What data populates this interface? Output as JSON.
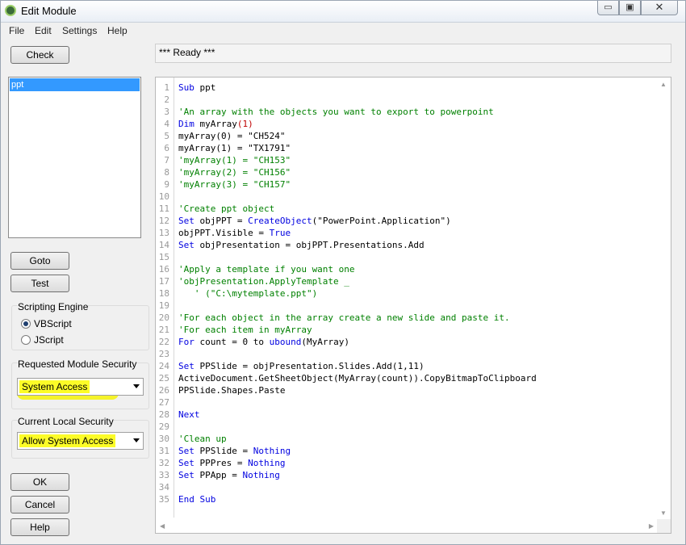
{
  "window": {
    "title": "Edit Module",
    "min_glyph": "▭",
    "max_glyph": "▣",
    "close_glyph": "✕"
  },
  "menu": [
    "File",
    "Edit",
    "Settings",
    "Help"
  ],
  "buttons": {
    "check": "Check",
    "goto": "Goto",
    "test": "Test",
    "ok": "OK",
    "cancel": "Cancel",
    "help": "Help"
  },
  "status": "*** Ready ***",
  "modules": [
    "ppt"
  ],
  "scripting_engine": {
    "label": "Scripting Engine",
    "options": [
      "VBScript",
      "JScript"
    ],
    "selected": "VBScript"
  },
  "requested_security": {
    "label": "Requested Module Security",
    "value": "System Access"
  },
  "local_security": {
    "label": "Current Local Security",
    "value": "Allow System Access"
  },
  "colors": {
    "highlight": "#f5f32a",
    "keyword": "#0000e0",
    "comment": "#008000",
    "selection": "#3399ff"
  },
  "code_lines": [
    [
      [
        "kw",
        "Sub"
      ],
      [
        "t",
        " ppt"
      ]
    ],
    [],
    [
      [
        "cm",
        "'An array with the objects you want to export to powerpoint"
      ]
    ],
    [
      [
        "kw",
        "Dim"
      ],
      [
        "t",
        " myArray"
      ],
      [
        "err",
        "(1)"
      ]
    ],
    [
      [
        "t",
        "myArray(0) = \"CH524\""
      ]
    ],
    [
      [
        "t",
        "myArray(1) = \"TX1791\""
      ]
    ],
    [
      [
        "cm",
        "'myArray(1) = \"CH153\""
      ]
    ],
    [
      [
        "cm",
        "'myArray(2) = \"CH156\""
      ]
    ],
    [
      [
        "cm",
        "'myArray(3) = \"CH157\""
      ]
    ],
    [],
    [
      [
        "cm",
        "'Create ppt object"
      ]
    ],
    [
      [
        "kw",
        "Set"
      ],
      [
        "t",
        " objPPT = "
      ],
      [
        "kw",
        "CreateObject"
      ],
      [
        "t",
        "(\"PowerPoint.Application\")"
      ]
    ],
    [
      [
        "t",
        "objPPT.Visible = "
      ],
      [
        "kw",
        "True"
      ]
    ],
    [
      [
        "kw",
        "Set"
      ],
      [
        "t",
        " objPresentation = objPPT.Presentations.Add"
      ]
    ],
    [],
    [
      [
        "cm",
        "'Apply a template if you want one"
      ]
    ],
    [
      [
        "cm",
        "'objPresentation.ApplyTemplate _"
      ]
    ],
    [
      [
        "cm",
        "   ' (\"C:\\mytemplate.ppt\")"
      ]
    ],
    [],
    [
      [
        "cm",
        "'For each object in the array create a new slide and paste it."
      ]
    ],
    [
      [
        "cm",
        "'For each item in myArray"
      ]
    ],
    [
      [
        "kw",
        "For"
      ],
      [
        "t",
        " count = 0 to "
      ],
      [
        "kw",
        "ubound"
      ],
      [
        "t",
        "(MyArray)"
      ]
    ],
    [],
    [
      [
        "kw",
        "Set"
      ],
      [
        "t",
        " PPSlide = objPresentation.Slides.Add(1,11)"
      ]
    ],
    [
      [
        "t",
        "ActiveDocument.GetSheetObject(MyArray(count)).CopyBitmapToClipboard"
      ]
    ],
    [
      [
        "t",
        "PPSlide.Shapes.Paste"
      ]
    ],
    [],
    [
      [
        "kw",
        "Next"
      ]
    ],
    [],
    [
      [
        "cm",
        "'Clean up"
      ]
    ],
    [
      [
        "kw",
        "Set"
      ],
      [
        "t",
        " PPSlide = "
      ],
      [
        "kw",
        "Nothing"
      ]
    ],
    [
      [
        "kw",
        "Set"
      ],
      [
        "t",
        " PPPres = "
      ],
      [
        "kw",
        "Nothing"
      ]
    ],
    [
      [
        "kw",
        "Set"
      ],
      [
        "t",
        " PPApp = "
      ],
      [
        "kw",
        "Nothing"
      ]
    ],
    [],
    [
      [
        "kw",
        "End Sub"
      ]
    ]
  ]
}
